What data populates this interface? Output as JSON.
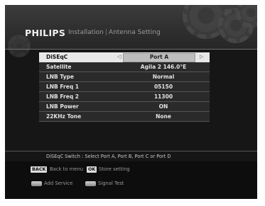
{
  "header": {
    "brand": "PHILIPS",
    "crumb_1": "Installation",
    "separator": "|",
    "crumb_2": "Antenna Setting"
  },
  "menu": {
    "rows": [
      {
        "label": "DiSEqC",
        "value": "Port A",
        "selected": true
      },
      {
        "label": "Satellite",
        "value": "Agila 2 146.0°E"
      },
      {
        "label": "LNB Type",
        "value": "Normal"
      },
      {
        "label": "LNB Freq 1",
        "value": "05150"
      },
      {
        "label": "LNB Freq 2",
        "value": "11300"
      },
      {
        "label": "LNB Power",
        "value": "ON"
      },
      {
        "label": "22KHz Tone",
        "value": "None"
      }
    ],
    "arrow_left": "◁",
    "arrow_right": "▷"
  },
  "hint": "DiSEqC Switch : Select Port A, Port B, Port C or Port D",
  "footer": {
    "back_key": "BACK",
    "back_text": "Back to menu",
    "ok_key": "OK",
    "ok_text": "Store setting",
    "add_service": "Add Service",
    "signal_test": "Signal Test"
  }
}
